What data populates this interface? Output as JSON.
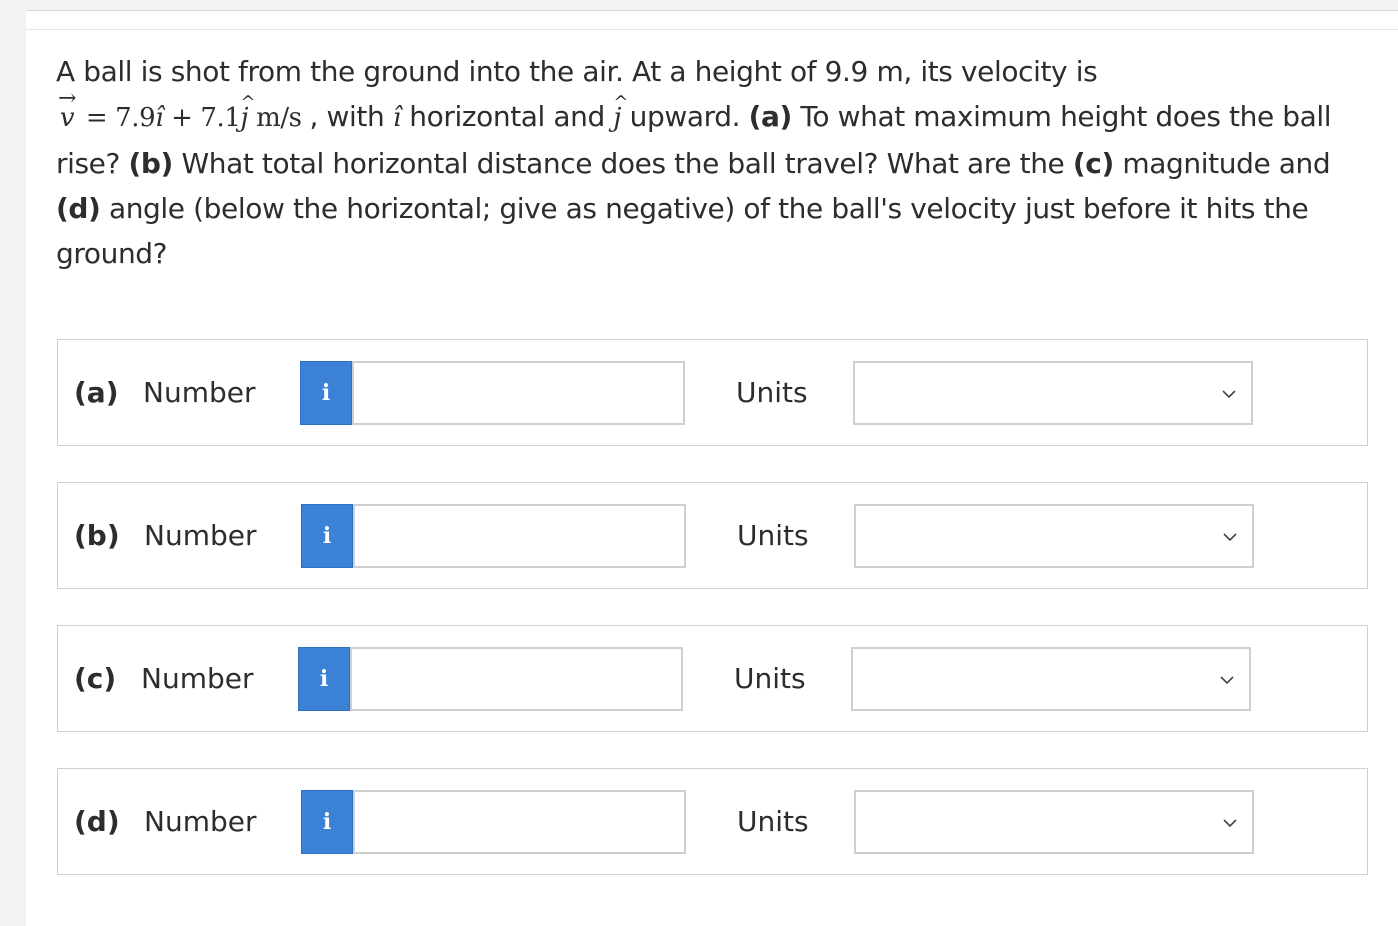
{
  "question": {
    "line1": "A ball is shot from the ground into the air. At a height of 9.9 m, its velocity is",
    "v_symbol": "v",
    "equals": "=",
    "i_coef": "7.9",
    "i_unit": "î",
    "plus": "+",
    "j_coef": "7.1",
    "j_unit": "j",
    "vel_unit": "m/s",
    "comma_with": ", with",
    "i_symbol": "î",
    "horizontal_and": "horizontal and",
    "j_symbol": "j",
    "upward": "upward.",
    "a_label": "(a)",
    "a_text": "To what maximum height does the ball rise?",
    "b_label": "(b)",
    "b_text": "What total horizontal distance does the ball travel? What are the",
    "c_label": "(c)",
    "c_text": "magnitude and",
    "d_label": "(d)",
    "d_text": "angle (below the horizontal; give as negative) of the ball's velocity just before it hits the ground?"
  },
  "answers": [
    {
      "part": "(a)",
      "number_label": "Number",
      "info": "i",
      "value": "",
      "units_label": "Units",
      "units_value": ""
    },
    {
      "part": "(b)",
      "number_label": "Number",
      "info": "i",
      "value": "",
      "units_label": "Units",
      "units_value": ""
    },
    {
      "part": "(c)",
      "number_label": "Number",
      "info": "i",
      "value": "",
      "units_label": "Units",
      "units_value": ""
    },
    {
      "part": "(d)",
      "number_label": "Number",
      "info": "i",
      "value": "",
      "units_label": "Units",
      "units_value": ""
    }
  ],
  "colors": {
    "info_button": "#3b82d6",
    "border": "#cfcfcf",
    "text": "#2d2d2d"
  },
  "icons": {
    "info": "info-icon",
    "dropdown": "chevron-down-icon"
  }
}
